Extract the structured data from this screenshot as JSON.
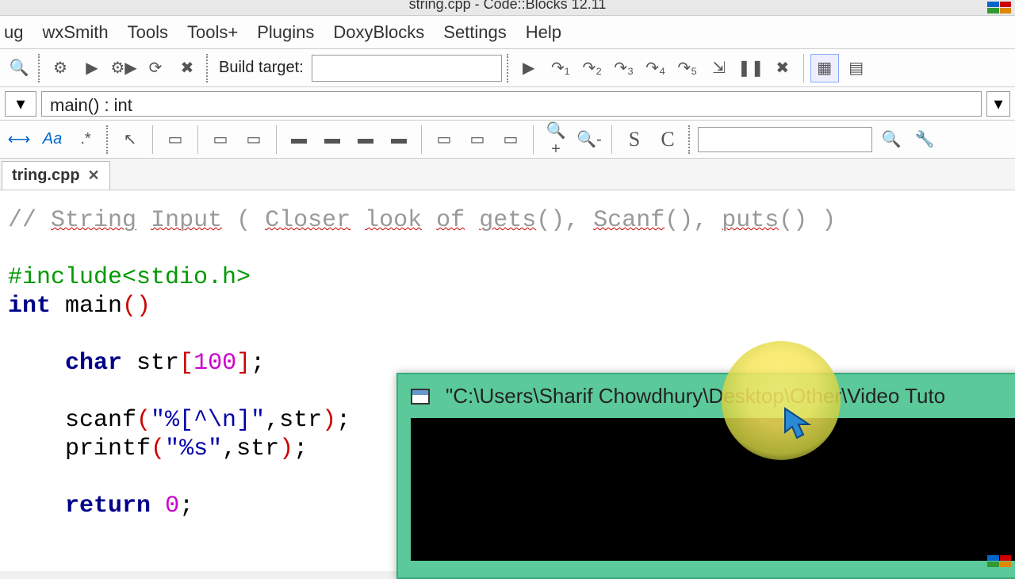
{
  "window": {
    "title": "string.cpp - Code::Blocks 12.11"
  },
  "menus": {
    "ug": "ug",
    "wxsmith": "wxSmith",
    "tools": "Tools",
    "toolsplus": "Tools+",
    "plugins": "Plugins",
    "doxyblocks": "DoxyBlocks",
    "settings": "Settings",
    "help": "Help"
  },
  "build": {
    "label": "Build target:",
    "value": ""
  },
  "scope": {
    "symbol": "main() : int"
  },
  "tab": {
    "name": "tring.cpp"
  },
  "code": {
    "comment": "// String Input ( Closer look of gets(), Scanf(), puts() )",
    "comment_parts": [
      "// ",
      "String",
      " ",
      "Input",
      " ( ",
      "Closer",
      " ",
      "look",
      " ",
      "of",
      " ",
      "gets",
      "(), ",
      "Scanf",
      "(), ",
      "puts",
      "() )"
    ],
    "l1_include": "#include<stdio.h>",
    "l2_int": "int",
    "l2_main": " main",
    "l2_p": "()",
    "l3": "",
    "l4_pad": "    ",
    "l4_char": "char",
    "l4_str": " str",
    "l4_b1": "[",
    "l4_100": "100",
    "l4_b2": "]",
    "l4_semi": ";",
    "l5_pad": "    ",
    "l5_call": "scanf",
    "l5_p1": "(",
    "l5_s": "\"%[^\\n]\"",
    "l5_rest": ",str",
    "l5_p2": ")",
    "l5_semi": ";",
    "l6_pad": "    ",
    "l6_call": "printf",
    "l6_p1": "(",
    "l6_s": "\"%s\"",
    "l6_rest": ",str",
    "l6_p2": ")",
    "l6_semi": ";",
    "l7_pad": "    ",
    "l7_ret": "return",
    "l7_sp": " ",
    "l7_0": "0",
    "l7_semi": ";"
  },
  "console": {
    "title": "\"C:\\Users\\Sharif Chowdhury\\Desktop\\Other\\Video Tuto"
  }
}
